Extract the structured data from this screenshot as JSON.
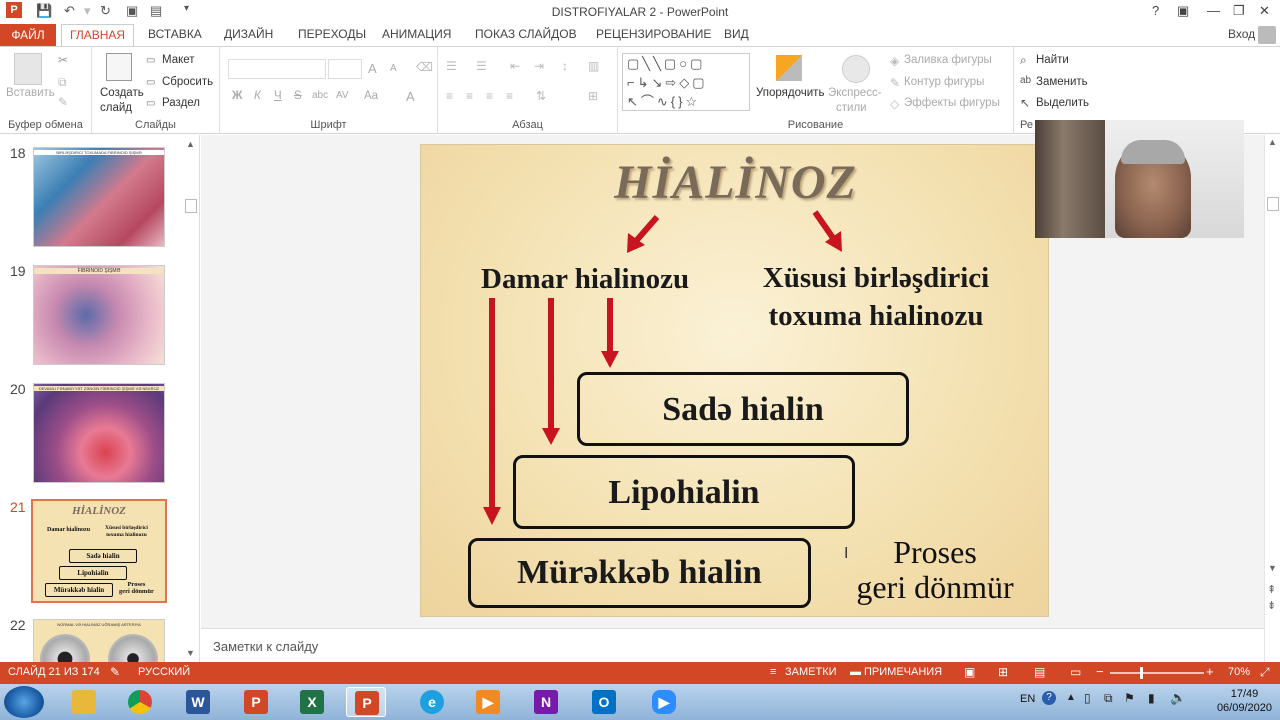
{
  "window": {
    "title": "DISTROFIYALAR 2 - PowerPoint",
    "help": "?",
    "min": "—",
    "restore": "❐",
    "close": "✕"
  },
  "tabs": {
    "file": "ФАЙЛ",
    "home": "ГЛАВНАЯ",
    "insert": "ВСТАВКА",
    "design": "ДИЗАЙН",
    "transitions": "ПЕРЕХОДЫ",
    "animation": "АНИМАЦИЯ",
    "slideshow": "ПОКАЗ СЛАЙДОВ",
    "review": "РЕЦЕНЗИРОВАНИЕ",
    "view": "ВИД",
    "signin": "Вход"
  },
  "ribbon": {
    "clipboard": {
      "paste": "Вставить",
      "label": "Буфер обмена"
    },
    "slides": {
      "new_slide_1": "Создать",
      "new_slide_2": "слайд",
      "layout": "Макет",
      "reset": "Сбросить",
      "section": "Раздел",
      "label": "Слайды"
    },
    "font": {
      "label": "Шрифт",
      "bold": "Ж",
      "italic": "К",
      "underline": "Ч",
      "strike": "S",
      "shadow": "abc",
      "spacing": "AV",
      "case": "Aa",
      "color": "A",
      "grow": "A",
      "shrink": "A"
    },
    "paragraph": {
      "label": "Абзац"
    },
    "drawing": {
      "arrange": "Упорядочить",
      "quick_styles_1": "Экспресс-",
      "quick_styles_2": "стили",
      "fill": "Заливка фигуры",
      "outline": "Контур фигуры",
      "effects": "Эффекты фигуры",
      "label": "Рисование"
    },
    "editing": {
      "find": "Найти",
      "replace": "Заменить",
      "select": "Выделить",
      "label": "Ре"
    }
  },
  "thumbnails": [
    {
      "num": "18",
      "caption": "BIRLƏŞDIRICI TOXUMADA FIBRINOID ŞIŞMƏ"
    },
    {
      "num": "19",
      "caption": "FIBRINOID ŞIŞMƏ"
    },
    {
      "num": "20",
      "caption": "DEVAMLI FƏNABİYYƏT ZƏNGİN FİBRİNOİD ŞİŞMƏ VƏ NEKROZ"
    },
    {
      "num": "21",
      "caption": ""
    },
    {
      "num": "22",
      "caption": "NORMAL VƏ HIALINƏZ UĞRAMIŞ ARTERIYA"
    }
  ],
  "slide": {
    "title": "HİALİNOZ",
    "left_branch": "Damar hialinozu",
    "right_branch_1": "Xüsusi birləşdirici",
    "right_branch_2": "toxuma hialinozu",
    "box1": "Sadə hialin",
    "box2": "Lipohialin",
    "box3": "Mürəkkəb hialin",
    "note_1": "Proses",
    "note_2": "geri dönmür",
    "colors": {
      "arrow": "#c8141e",
      "background": "#f4e2b3",
      "title": "#7a6a5a"
    }
  },
  "notes_placeholder": "Заметки к слайду",
  "status": {
    "slide_info": "СЛАЙД 21 ИЗ 174",
    "language": "РУССКИЙ",
    "notes": "ЗАМЕТКИ",
    "comments": "ПРИМЕЧАНИЯ",
    "zoom": "70%"
  },
  "taskbar": {
    "lang": "EN",
    "time": "17/49",
    "date": "06/09/2020"
  }
}
